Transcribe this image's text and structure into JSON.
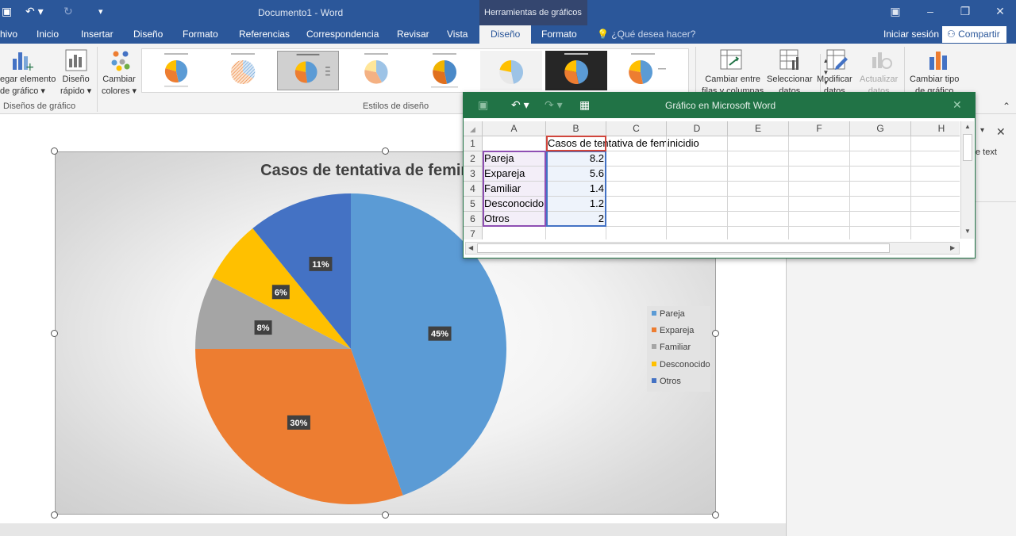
{
  "window": {
    "doc_title": "Documento1 - Word",
    "context_tab_header": "Herramientas de gráficos"
  },
  "tabs": [
    {
      "label": "hivo"
    },
    {
      "label": "Inicio"
    },
    {
      "label": "Insertar"
    },
    {
      "label": "Diseño"
    },
    {
      "label": "Formato"
    },
    {
      "label": "Referencias"
    },
    {
      "label": "Correspondencia"
    },
    {
      "label": "Revisar"
    },
    {
      "label": "Vista"
    },
    {
      "label": "Diseño",
      "active": true
    },
    {
      "label": "Formato"
    }
  ],
  "tell_me": "¿Qué desea hacer?",
  "account": {
    "signin": "Iniciar sesión",
    "share": "Compartir"
  },
  "ribbon": {
    "add_element_1": "egar elemento",
    "add_element_2": "de gráfico ▾",
    "quick_layout_1": "Diseño",
    "quick_layout_2": "rápido ▾",
    "change_colors_1": "Cambiar",
    "change_colors_2": "colores ▾",
    "group_layouts": "Diseños de gráfico",
    "group_styles": "Estilos de diseño",
    "switch_rows_1": "Cambiar entre",
    "switch_rows_2": "filas y columnas",
    "select_data_1": "Seleccionar",
    "select_data_2": "datos",
    "edit_data_1": "Modificar",
    "edit_data_2": "datos",
    "refresh_data_1": "Actualizar",
    "refresh_data_2": "datos",
    "change_type_1": "Cambiar tipo",
    "change_type_2": "de gráfico"
  },
  "chart_data": {
    "type": "pie",
    "title": "Casos de tentativa de feminicidio",
    "categories": [
      "Pareja",
      "Expareja",
      "Familiar",
      "Desconocido",
      "Otros"
    ],
    "values": [
      8.2,
      5.6,
      1.4,
      1.2,
      2
    ],
    "data_labels": [
      "45%",
      "30%",
      "8%",
      "6%",
      "11%"
    ],
    "colors": [
      "#5b9bd5",
      "#ed7d31",
      "#a5a5a5",
      "#ffc000",
      "#4472c4"
    ],
    "legend_position": "right"
  },
  "excel": {
    "title": "Gráfico en Microsoft Word",
    "columns": [
      "A",
      "B",
      "C",
      "D",
      "E",
      "F",
      "G",
      "H"
    ],
    "rows": [
      {
        "n": "1",
        "a": "",
        "b": "Casos de tentativa de feminicidio"
      },
      {
        "n": "2",
        "a": "Pareja",
        "b": "8.2"
      },
      {
        "n": "3",
        "a": "Expareja",
        "b": "5.6"
      },
      {
        "n": "4",
        "a": "Familiar",
        "b": "1.4"
      },
      {
        "n": "5",
        "a": "Desconocido",
        "b": "1.2"
      },
      {
        "n": "6",
        "a": "Otros",
        "b": "2"
      },
      {
        "n": "7",
        "a": "",
        "b": ""
      }
    ]
  },
  "pane": {
    "text_fragment": "e text"
  }
}
